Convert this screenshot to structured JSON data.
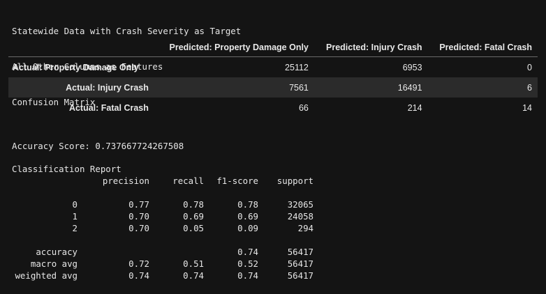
{
  "header": {
    "line1": "Statewide Data with Crash Severity as Target",
    "line2": "All Other Columns as Features",
    "line3": "Confusion Matrix"
  },
  "confusion_matrix": {
    "columns": [
      "",
      "Predicted: Property Damage Only",
      "Predicted: Injury Crash",
      "Predicted: Fatal Crash"
    ],
    "rows": [
      {
        "label": "Actual: Property Damage Only",
        "values": [
          "25112",
          "6953",
          "0"
        ]
      },
      {
        "label": "Actual: Injury Crash",
        "values": [
          "7561",
          "16491",
          "6"
        ]
      },
      {
        "label": "Actual: Fatal Crash",
        "values": [
          "66",
          "214",
          "14"
        ]
      }
    ]
  },
  "accuracy": {
    "text": "Accuracy Score: 0.737667724267508"
  },
  "report": {
    "title": "Classification Report",
    "headers": [
      "",
      "precision",
      "recall",
      "f1-score",
      "support"
    ],
    "rows": [
      [
        "",
        "",
        "",
        "",
        ""
      ],
      [
        "0",
        "0.77",
        "0.78",
        "0.78",
        "32065"
      ],
      [
        "1",
        "0.70",
        "0.69",
        "0.69",
        "24058"
      ],
      [
        "2",
        "0.70",
        "0.05",
        "0.09",
        "294"
      ],
      [
        "",
        "",
        "",
        "",
        ""
      ],
      [
        "accuracy",
        "",
        "",
        "0.74",
        "56417"
      ],
      [
        "macro avg",
        "0.72",
        "0.51",
        "0.52",
        "56417"
      ],
      [
        "weighted avg",
        "0.74",
        "0.74",
        "0.74",
        "56417"
      ]
    ]
  }
}
